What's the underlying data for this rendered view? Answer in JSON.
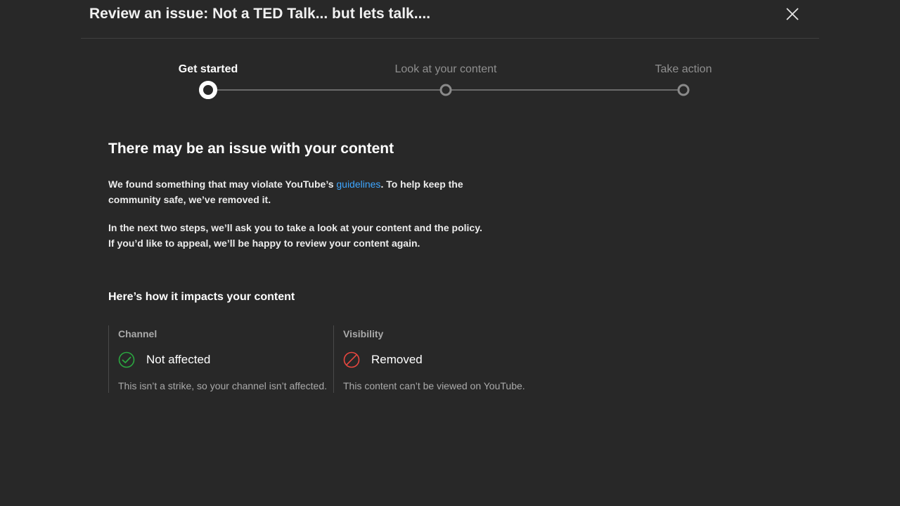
{
  "dialog": {
    "title": "Review an issue: Not a TED Talk... but lets talk...."
  },
  "stepper": {
    "steps": [
      {
        "label": "Get started",
        "state": "active"
      },
      {
        "label": "Look at your content",
        "state": "inactive"
      },
      {
        "label": "Take action",
        "state": "inactive"
      }
    ]
  },
  "main": {
    "heading": "There may be an issue with your content",
    "para1_before_link": "We found something that may violate YouTube’s ",
    "para1_link": "guidelines",
    "para1_after_link": ". To help keep the community safe, we’ve removed it.",
    "para2": "In the next two steps, we’ll ask you to take a look at your content and the policy. If you’d like to appeal, we’ll be happy to review your content again.",
    "impact_heading": "Here’s how it impacts your content"
  },
  "impacts": [
    {
      "label": "Channel",
      "value": "Not affected",
      "description": "This isn’t a strike, so your channel isn’t affected.",
      "icon": "check-circle-icon",
      "color": "#2ba640"
    },
    {
      "label": "Visibility",
      "value": "Removed",
      "description": "This content can’t be viewed on YouTube.",
      "icon": "prohibited-icon",
      "color": "#e8473f"
    }
  ],
  "colors": {
    "background": "#282828",
    "link": "#3ea6ff",
    "success": "#2ba640",
    "error": "#e8473f"
  }
}
